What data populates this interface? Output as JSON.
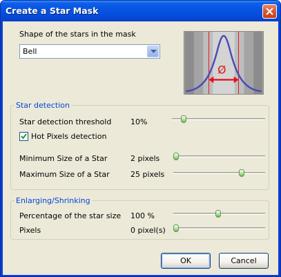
{
  "window": {
    "title": "Create a Star Mask"
  },
  "shape": {
    "label": "Shape of the stars in the mask",
    "selected": "Bell",
    "preview_symbol": "Ø"
  },
  "star_detection": {
    "title": "Star detection",
    "threshold": {
      "label": "Star detection threshold",
      "value": "10%",
      "fraction": 0.1
    },
    "hot_pixels": {
      "label": "Hot Pixels detection",
      "checked": true
    },
    "min_size": {
      "label": "Minimum Size of a Star",
      "value": "2 pixels",
      "fraction": 0.0
    },
    "max_size": {
      "label": "Maximum Size of a Star",
      "value": "25 pixels",
      "fraction": 0.76
    }
  },
  "enlarging": {
    "title": "Enlarging/Shrinking",
    "percentage": {
      "label": "Percentage of the star size",
      "value": "100 %",
      "fraction": 0.49
    },
    "pixels": {
      "label": "Pixels",
      "value": "0 pixel(s)",
      "fraction": 0.0
    }
  },
  "buttons": {
    "ok": "OK",
    "cancel": "Cancel"
  },
  "colors": {
    "group_title": "#0046d5",
    "curve": "#4a4ab8",
    "marker": "#e0141e"
  }
}
